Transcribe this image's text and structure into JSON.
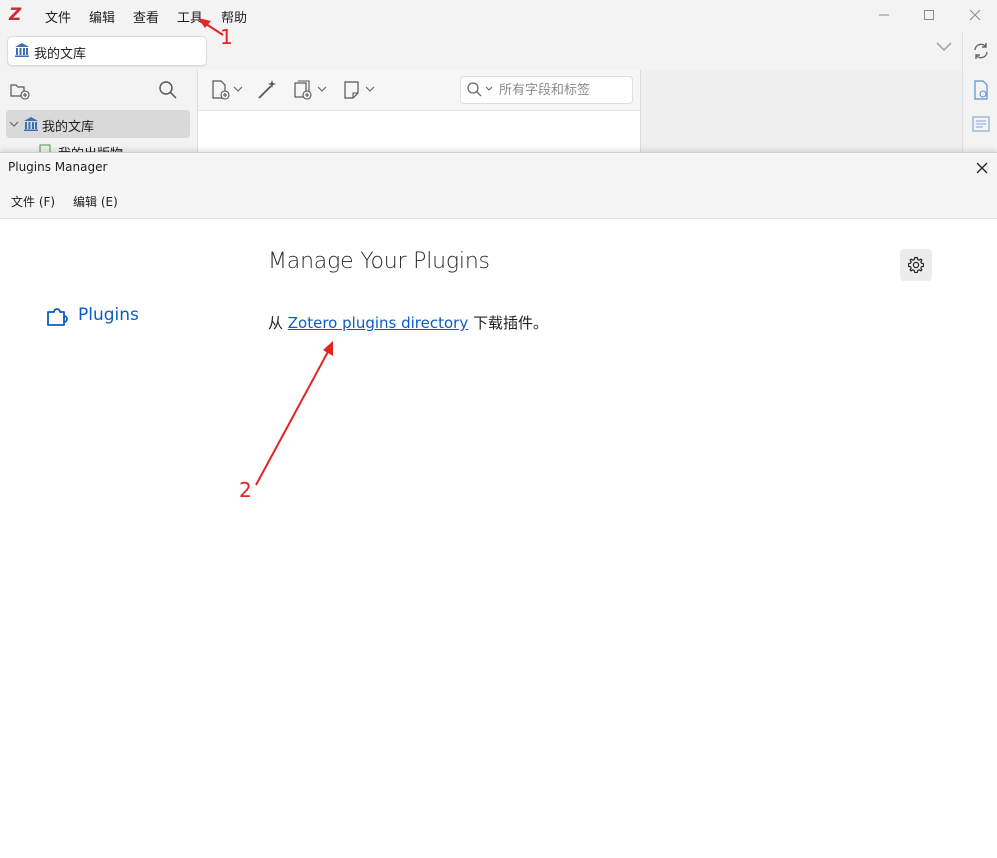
{
  "app": {
    "logo": "Z",
    "menu": [
      "文件",
      "编辑",
      "查看",
      "工具",
      "帮助"
    ]
  },
  "library_tab": {
    "label": "我的文库"
  },
  "left_pane": {
    "tree": [
      {
        "label": "我的文库",
        "expanded": true
      },
      {
        "label": "我的出版物"
      }
    ]
  },
  "items_toolbar": {
    "search_placeholder": "所有字段和标签"
  },
  "dialog": {
    "title": "Plugins Manager",
    "menu": [
      "文件 (F)",
      "编辑 (E)"
    ],
    "category": "Plugins",
    "heading": "Manage Your Plugins",
    "desc_prefix": "从 ",
    "desc_link": "Zotero plugins directory",
    "desc_suffix": " 下载插件。"
  },
  "annotations": {
    "label_1": "1",
    "label_2": "2",
    "color": "#e0261f"
  },
  "colors": {
    "accent": "#0a5cc6",
    "logo": "#cc2936"
  }
}
